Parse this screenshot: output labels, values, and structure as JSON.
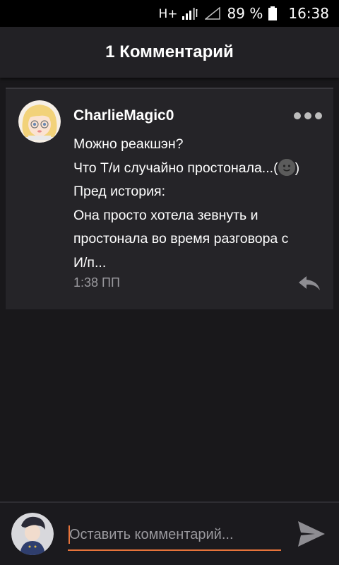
{
  "status_bar": {
    "network": "H+",
    "battery_percent": "89 %",
    "time": "16:38"
  },
  "header": {
    "title": "1 Комментарий"
  },
  "comment": {
    "username": "CharlieMagic0",
    "avatar_icon": "anime-avatar",
    "lines": [
      "Можно реакшэн?",
      "Что Т/и случайно простонала...(",
      "Пред история:",
      "Она просто хотела зевнуть и",
      "простонала во время разговора с",
      "И/п..."
    ],
    "emoji_suffix": ")",
    "timestamp": "1:38 ПП",
    "more_icon": "more-dots-icon",
    "reply_icon": "reply-icon"
  },
  "composer": {
    "placeholder": "Оставить комментарий...",
    "value": "",
    "send_icon": "send-icon",
    "accent_color": "#e8743b"
  },
  "colors": {
    "background": "#19181b",
    "header": "#222125",
    "card": "#252428",
    "muted_text": "#9a999e"
  }
}
